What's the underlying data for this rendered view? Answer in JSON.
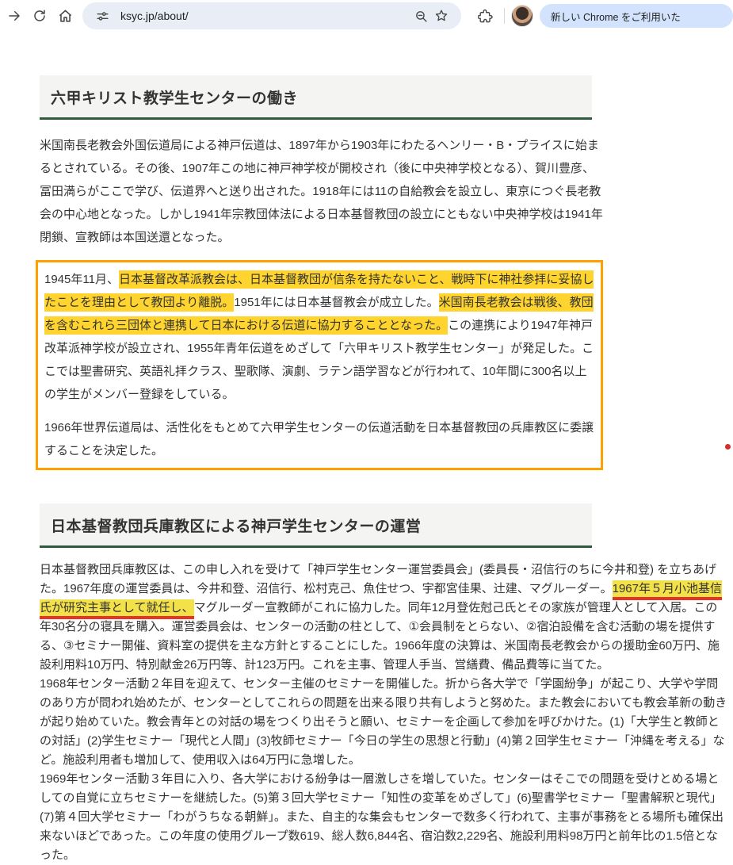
{
  "colors": {
    "highlight_section1": "#ffd42e",
    "highlight_section2": "#f3e149",
    "annotation_box_border": "#ffa000",
    "annotation_underline": "#e53328",
    "heading_underline": "#2e5a3e",
    "omnibox_bg": "#e9eef6",
    "promo_pill_bg": "#d3e3fd"
  },
  "browser": {
    "url": "ksyc.jp/about/",
    "promo_button_label": "新しい Chrome をご利用いた",
    "icons": [
      "forward-icon",
      "reload-icon",
      "home-icon",
      "site-info-icon",
      "zoom-out-icon",
      "bookmark-star-icon",
      "extensions-puzzle-icon",
      "profile-avatar"
    ]
  },
  "section1": {
    "heading": "六甲キリスト教学生センターの働き",
    "paragraph1": "米国南長老教会外国伝道局による神戸伝道は、1897年から1903年にわたるヘンリー・B・プライスに始まるとされている。その後、1907年この地に神戸神学校が開校され（後に中央神学校となる）、賀川豊彦、冨田満らがここで学び、伝道界へと送り出された。1918年には11の自給教会を設立し、東京につぐ長老教会の中心地となった。しかし1941年宗教団体法による日本基督教団の設立にともない中央神学校は1941年閉鎖、宣教師は本国送還となった。",
    "boxed_paragraph_segments": [
      {
        "t": "1945年11月、",
        "hl": false
      },
      {
        "t": "日本基督改革派教会は、日本基督教団が信条を持たないこと、戦時下に神社参拝に妥協したことを理由として教団より離脱。",
        "hl": true
      },
      {
        "t": "1951年には日本基督教会が成立した。",
        "hl": false
      },
      {
        "t": "米国南長老教会は戦後、教団を含むこれら三団体と連携して日本における伝道に協力することとなった。",
        "hl": true
      },
      {
        "t": "この連携により1947年神戸改革派神学校が設立され、1955年青年伝道をめざして「六甲キリスト教学生センター」が発足した。ここでは聖書研究、英語礼拝クラス、聖歌隊、演劇、ラテン語学習などが行われて、10年間に300名以上の学生がメンバー登録をしている。",
        "hl": false
      }
    ],
    "boxed_paragraph2": "1966年世界伝道局は、活性化をもとめて六甲学生センターの伝道活動を日本基督教団の兵庫教区に委譲することを決定した。"
  },
  "section2": {
    "heading": "日本基督教団兵庫教区による神戸学生センターの運営",
    "paragraphA_segments": [
      {
        "t": "日本基督教団兵庫教区は、この申し入れを受けて「神戸学生センター運営委員会」(委員長・沼信行のちに今井和登) を立ちあげた。1967年度の運営委員は、今井和登、沼信行、松村克己、魚住せつ、宇都宮佳果、辻建、マグルーダー。",
        "hl": false
      },
      {
        "t": "1967年５月小池基信氏が研究主事として就任し、",
        "hl": true,
        "ul": true
      },
      {
        "t": "マグルーダー宣教師がこれに協力した。同年12月登佐尅己氏とその家族が管理人として入居。この年30名分の寝具を購入。運営委員会は、センターの活動の柱として、①会員制をとらない、②宿泊設備を含む活動の場を提供する、③セミナー開催、資料室の提供を主な方針とすることにした。1966年度の決算は、米国南長老教会からの援助金60万円、施設利用料10万円、特別献金26万円等、計123万円。これを主事、管理人手当、営繕費、備品費等に当てた。",
        "hl": false
      }
    ],
    "paragraphB": "1968年センター活動２年目を迎えて、センター主催のセミナーを開催した。折から各大学で「学園紛争」が起こり、大学や学問のあり方が問われ始めたが、センターとしてこれらの問題を出来る限り共有しようと努めた。また教会においても教会革新の動きが起り始めていた。教会青年との対話の場をつくり出そうと願い、セミナーを企画して参加を呼びかけた。(1)「大学生と教師との対話」(2)学生セミナー「現代と人間」(3)牧師セミナー「今日の学生の思想と行動」(4)第２回学生セミナー「沖縄を考える」など。施設利用者も増加して、使用収入は64万円に急増した。",
    "paragraphC": "1969年センター活動３年目に入り、各大学における紛争は一層激しさを増していた。センターはそこでの問題を受けとめる場としての自覚に立ちセミナーを継続した。(5)第３回大学セミナー「知性の変革をめざして」(6)聖書学セミナー「聖書解釈と現代」(7)第４回大学セミナー「わがうちなる朝鮮」。また、自主的な集会もセンターで数多く行われて、主事が事務をとる場所も確保出来ないほどであった。この年度の使用グループ数619、総人数6,844名、宿泊数2,229名、施設利用料98万円と前年比の1.5倍となった。"
  }
}
